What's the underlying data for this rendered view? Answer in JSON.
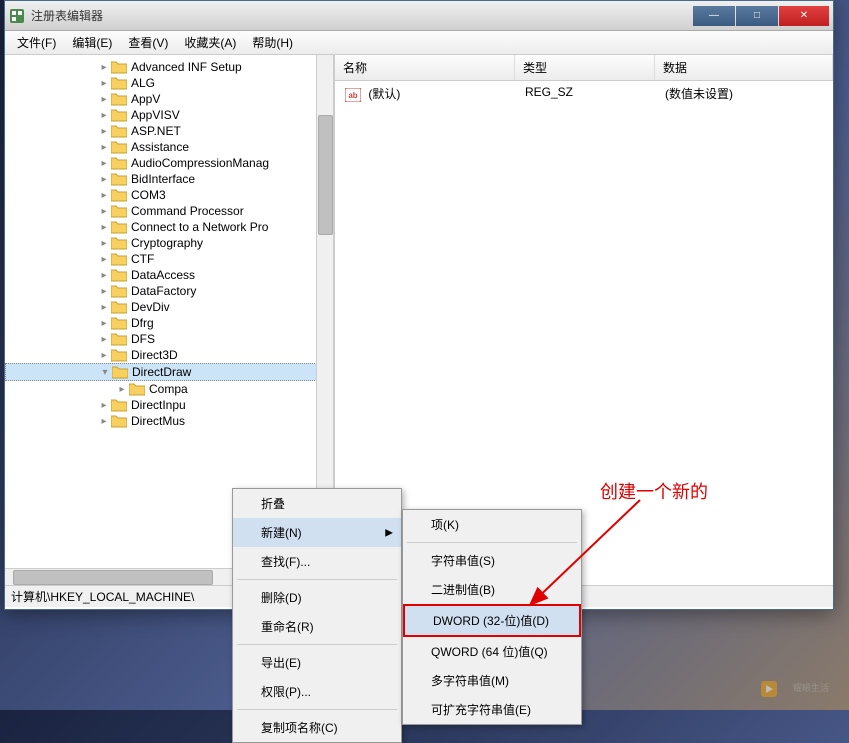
{
  "window": {
    "title": "注册表编辑器"
  },
  "menubar": {
    "items": [
      "文件(F)",
      "编辑(E)",
      "查看(V)",
      "收藏夹(A)",
      "帮助(H)"
    ]
  },
  "tree": {
    "items": [
      {
        "label": "Advanced INF Setup",
        "depth": 4,
        "expanded": false
      },
      {
        "label": "ALG",
        "depth": 4,
        "expanded": false
      },
      {
        "label": "AppV",
        "depth": 4,
        "expanded": false
      },
      {
        "label": "AppVISV",
        "depth": 4,
        "expanded": false
      },
      {
        "label": "ASP.NET",
        "depth": 4,
        "expanded": false
      },
      {
        "label": "Assistance",
        "depth": 4,
        "expanded": false
      },
      {
        "label": "AudioCompressionManag",
        "depth": 4,
        "expanded": false
      },
      {
        "label": "BidInterface",
        "depth": 4,
        "expanded": false
      },
      {
        "label": "COM3",
        "depth": 4,
        "expanded": false
      },
      {
        "label": "Command Processor",
        "depth": 4,
        "expanded": false
      },
      {
        "label": "Connect to a Network Pro",
        "depth": 4,
        "expanded": false
      },
      {
        "label": "Cryptography",
        "depth": 4,
        "expanded": false
      },
      {
        "label": "CTF",
        "depth": 4,
        "expanded": false
      },
      {
        "label": "DataAccess",
        "depth": 4,
        "expanded": false
      },
      {
        "label": "DataFactory",
        "depth": 4,
        "expanded": false
      },
      {
        "label": "DevDiv",
        "depth": 4,
        "expanded": false
      },
      {
        "label": "Dfrg",
        "depth": 4,
        "expanded": false
      },
      {
        "label": "DFS",
        "depth": 4,
        "expanded": false
      },
      {
        "label": "Direct3D",
        "depth": 4,
        "expanded": false
      },
      {
        "label": "DirectDraw",
        "depth": 4,
        "expanded": true,
        "selected": true
      },
      {
        "label": "Compa",
        "depth": 5,
        "expanded": false
      },
      {
        "label": "DirectInpu",
        "depth": 4,
        "expanded": false
      },
      {
        "label": "DirectMus",
        "depth": 4,
        "expanded": false
      }
    ]
  },
  "list": {
    "headers": {
      "name": "名称",
      "type": "类型",
      "data": "数据"
    },
    "rows": [
      {
        "name": "(默认)",
        "type": "REG_SZ",
        "data": "(数值未设置)"
      }
    ]
  },
  "statusbar": {
    "path": "计算机\\HKEY_LOCAL_MACHINE\\"
  },
  "context_menu": {
    "items": [
      {
        "label": "折叠",
        "type": "item"
      },
      {
        "label": "新建(N)",
        "type": "submenu",
        "highlighted": true
      },
      {
        "label": "查找(F)...",
        "type": "item"
      },
      {
        "type": "sep"
      },
      {
        "label": "删除(D)",
        "type": "item"
      },
      {
        "label": "重命名(R)",
        "type": "item"
      },
      {
        "type": "sep"
      },
      {
        "label": "导出(E)",
        "type": "item"
      },
      {
        "label": "权限(P)...",
        "type": "item"
      },
      {
        "type": "sep"
      },
      {
        "label": "复制项名称(C)",
        "type": "item"
      }
    ]
  },
  "submenu": {
    "items": [
      {
        "label": "项(K)",
        "type": "item"
      },
      {
        "type": "sep"
      },
      {
        "label": "字符串值(S)",
        "type": "item"
      },
      {
        "label": "二进制值(B)",
        "type": "item"
      },
      {
        "label": "DWORD (32-位)值(D)",
        "type": "item",
        "highlighted": true,
        "boxed": true
      },
      {
        "label": "QWORD (64 位)值(Q)",
        "type": "item"
      },
      {
        "label": "多字符串值(M)",
        "type": "item"
      },
      {
        "label": "可扩充字符串值(E)",
        "type": "item"
      }
    ]
  },
  "annotation": {
    "text": "创建一个新的"
  }
}
